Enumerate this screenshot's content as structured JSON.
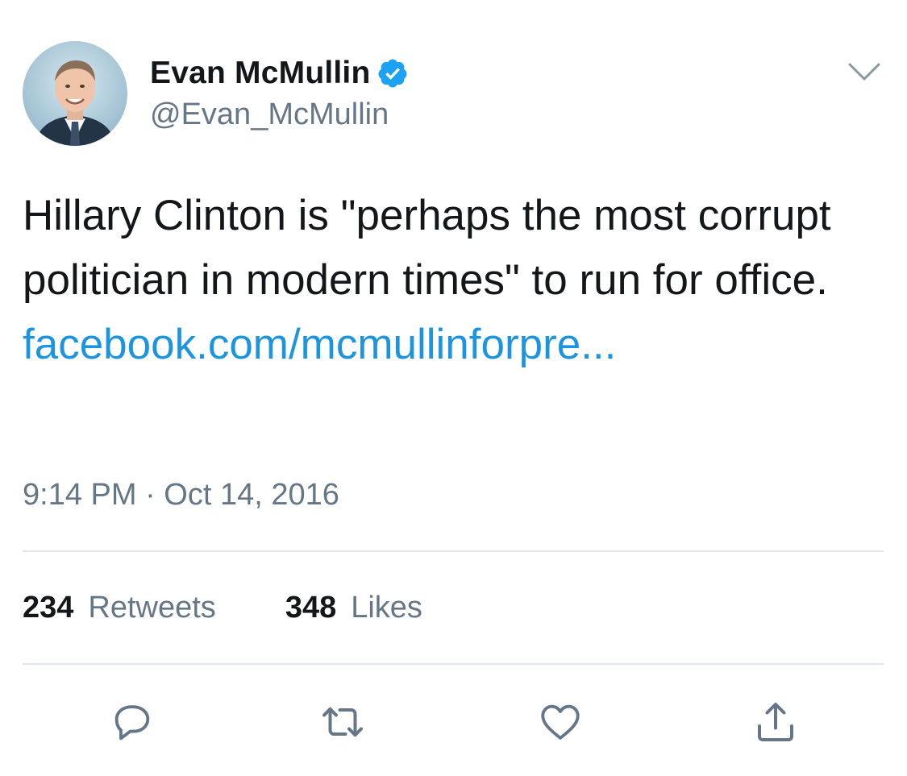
{
  "user": {
    "display_name": "Evan McMullin",
    "handle": "@Evan_McMullin",
    "verified": true,
    "avatar_icon": "profile-photo"
  },
  "tweet": {
    "text": "Hillary Clinton is \"perhaps the most corrupt politician in modern times\" to run for office.",
    "link": "facebook.com/mcmullinforpre...",
    "timestamp": "9:14 PM · Oct 14, 2016"
  },
  "stats": {
    "retweets_count": "234",
    "retweets_label": "Retweets",
    "likes_count": "348",
    "likes_label": "Likes"
  },
  "actions": {
    "reply_icon": "reply-icon",
    "retweet_icon": "retweet-icon",
    "like_icon": "heart-icon",
    "share_icon": "share-icon"
  },
  "colors": {
    "link": "#1b95e0",
    "verified": "#1da1f2",
    "secondary_text": "#657786",
    "primary_text": "#14171a",
    "divider": "#e1e8ed"
  }
}
